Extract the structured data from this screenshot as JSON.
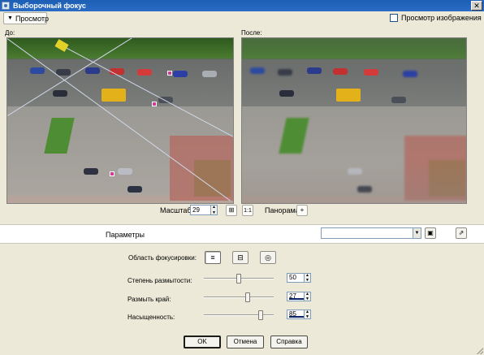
{
  "window": {
    "title": "Выборочный фокус",
    "close_glyph": "✕"
  },
  "toolbar": {
    "view_label": "Просмотр",
    "preview_checkbox_label": "Просмотр изображения",
    "preview_checked": false
  },
  "panels": {
    "before_label": "До:",
    "after_label": "После:"
  },
  "zoom": {
    "label": "Масштаб:",
    "value": "29",
    "fit_icon": "fit-to-window-icon",
    "actual_icon": "actual-size-icon"
  },
  "pan": {
    "label": "Панорама:",
    "icon": "plus-icon"
  },
  "params": {
    "label": "Параметры",
    "preset_value": "",
    "save_icon": "save-icon",
    "delete_icon": "delete-preset-icon"
  },
  "focus_area": {
    "label": "Область фокусировки:",
    "modes": [
      {
        "icon": "linear-focus-icon",
        "active": true
      },
      {
        "icon": "rectangular-focus-icon",
        "active": false
      },
      {
        "icon": "elliptical-focus-icon",
        "active": false
      }
    ]
  },
  "sliders": [
    {
      "label": "Степень размытости:",
      "value": "50",
      "percent": 50
    },
    {
      "label": "Размыть край:",
      "value": "27",
      "percent": 63
    },
    {
      "label": "Насыщенность:",
      "value": "85",
      "percent": 82
    }
  ],
  "buttons": {
    "ok": "OK",
    "cancel": "Отмена",
    "help": "Справка"
  },
  "colors": {
    "titlebar": "#1e5fb5",
    "handle": "#d33a9a",
    "yellow_bus": "#e3b11a"
  }
}
